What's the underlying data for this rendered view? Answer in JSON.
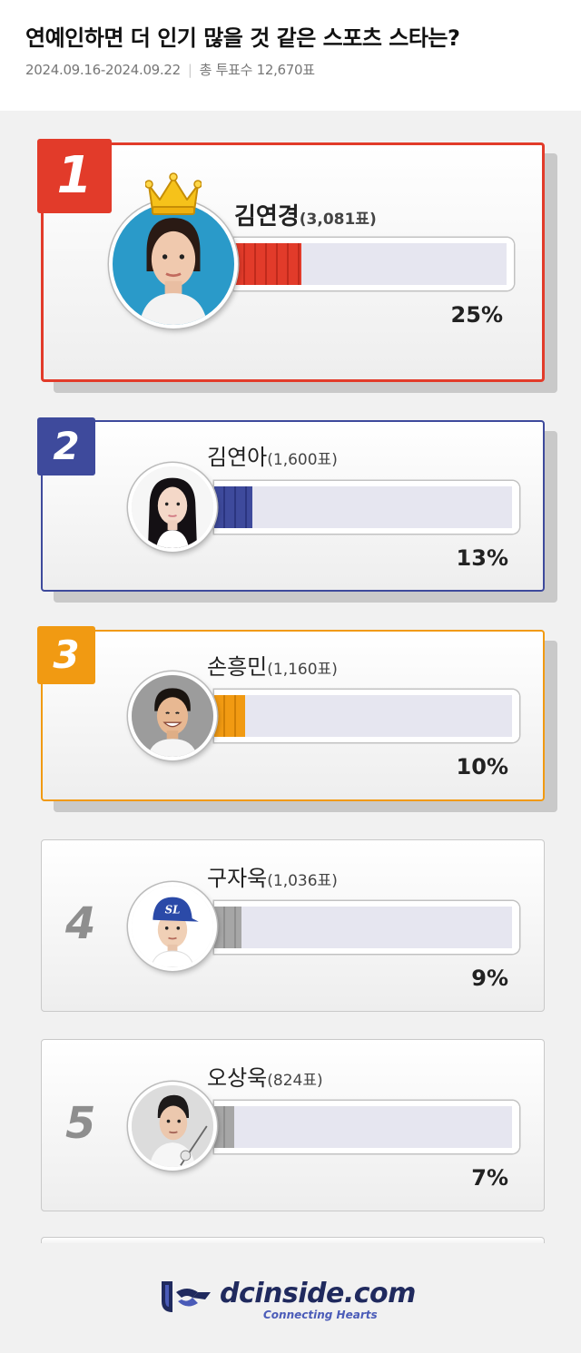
{
  "header": {
    "title": "연예인하면 더 인기 많을 것 같은 스포츠 스타는?",
    "period": "2024.09.16-2024.09.22",
    "total_label": "총 투표수 12,670표"
  },
  "entries": [
    {
      "rank": "1",
      "name": "김연경",
      "votes": "(3,081표)",
      "percent": "25%",
      "share": 0.25,
      "color": "#e23b2a",
      "accent": "#b82417"
    },
    {
      "rank": "2",
      "name": "김연아",
      "votes": "(1,600표)",
      "percent": "13%",
      "share": 0.13,
      "color": "#3e4a9c",
      "accent": "#2a3478"
    },
    {
      "rank": "3",
      "name": "손흥민",
      "votes": "(1,160표)",
      "percent": "10%",
      "share": 0.1,
      "color": "#f19a12",
      "accent": "#c77a05"
    },
    {
      "rank": "4",
      "name": "구자욱",
      "votes": "(1,036표)",
      "percent": "9%",
      "share": 0.09,
      "color": "#a6a6a6",
      "accent": "#8a8a8a"
    },
    {
      "rank": "5",
      "name": "오상욱",
      "votes": "(824표)",
      "percent": "7%",
      "share": 0.07,
      "color": "#a6a6a6",
      "accent": "#8a8a8a"
    }
  ],
  "footer": {
    "logo_text": "dcinside.com",
    "logo_sub": "Connecting Hearts"
  },
  "icons": {
    "crown": "crown-icon",
    "logo": "dcinside-logo-icon"
  }
}
